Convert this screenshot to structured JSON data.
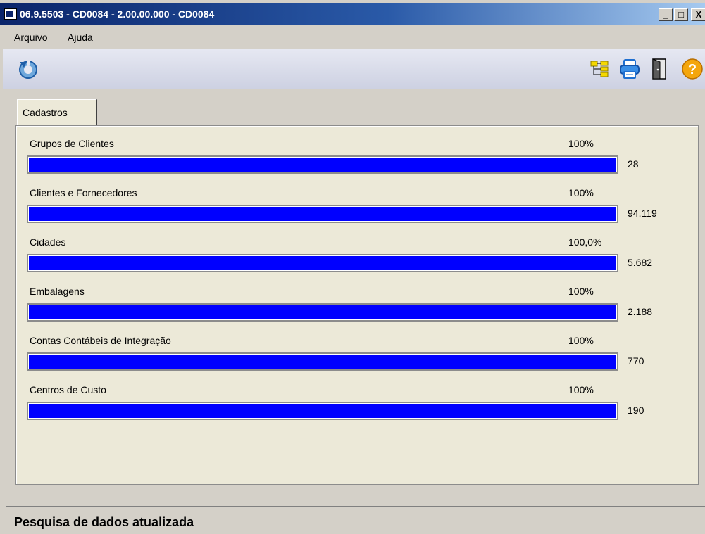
{
  "window": {
    "title": "06.9.5503 - CD0084 - 2.00.00.000 - CD0084",
    "min_glyph": "_",
    "max_glyph": "□",
    "close_glyph": "X"
  },
  "menu": {
    "arquivo": {
      "pre": "",
      "accel": "A",
      "post": "rquivo"
    },
    "ajuda": {
      "pre": "Aj",
      "accel": "u",
      "post": "da"
    }
  },
  "toolbar": {
    "refresh_icon": "refresh-icon",
    "tree_icon": "tree-icon",
    "print_icon": "printer-icon",
    "exit_icon": "exit-door-icon",
    "help_icon": "help-icon",
    "help_glyph": "?"
  },
  "tabs": [
    {
      "label": "Cadastros"
    }
  ],
  "progress_rows": [
    {
      "label": "Grupos de Clientes",
      "percent_text": "100%",
      "progress": 1.0,
      "count": "28"
    },
    {
      "label": "Clientes e Fornecedores",
      "percent_text": "100%",
      "progress": 1.0,
      "count": "94.119"
    },
    {
      "label": "Cidades",
      "percent_text": "100,0%",
      "progress": 1.0,
      "count": "5.682"
    },
    {
      "label": "Embalagens",
      "percent_text": "100%",
      "progress": 1.0,
      "count": "2.188"
    },
    {
      "label": "Contas Contábeis de Integração",
      "percent_text": "100%",
      "progress": 1.0,
      "count": "770"
    },
    {
      "label": "Centros de Custo",
      "percent_text": "100%",
      "progress": 1.0,
      "count": "190"
    }
  ],
  "status": {
    "text": "Pesquisa de dados atualizada"
  },
  "colors": {
    "progress_fill": "#0000ff",
    "title_bar": "#0a246a"
  }
}
